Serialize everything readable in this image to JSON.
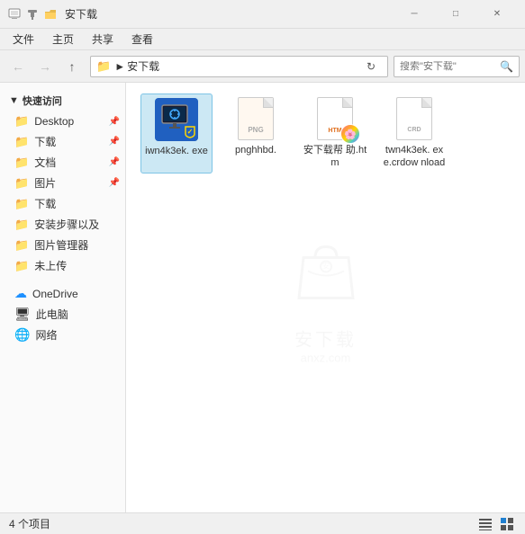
{
  "titlebar": {
    "title": "安下载",
    "controls": {
      "minimize": "─",
      "maximize": "□",
      "close": "✕"
    }
  },
  "menubar": {
    "items": [
      "文件",
      "主页",
      "共享",
      "查看"
    ]
  },
  "toolbar": {
    "back_title": "后退",
    "forward_title": "前进",
    "up_title": "向上",
    "address": "安下载",
    "address_folder": "▶",
    "refresh_title": "刷新",
    "search_placeholder": "搜索\"安下载\""
  },
  "sidebar": {
    "quick_access_label": "快速访问",
    "items": [
      {
        "label": "Desktop",
        "icon": "folder",
        "pinned": true
      },
      {
        "label": "下载",
        "icon": "folder",
        "pinned": true
      },
      {
        "label": "文档",
        "icon": "folder",
        "pinned": true
      },
      {
        "label": "图片",
        "icon": "folder",
        "pinned": true
      },
      {
        "label": "下载",
        "icon": "folder"
      },
      {
        "label": "安装步骤以及",
        "icon": "folder"
      },
      {
        "label": "图片管理器",
        "icon": "folder"
      },
      {
        "label": "未上传",
        "icon": "folder"
      }
    ],
    "onedrive_label": "OneDrive",
    "pc_label": "此电脑",
    "network_label": "网络"
  },
  "files": [
    {
      "name": "iwn4k3ek.\nexe",
      "type": "exe"
    },
    {
      "name": "pnghhbd.",
      "type": "generic"
    },
    {
      "name": "安下载帮\n助.htm",
      "type": "htm"
    },
    {
      "name": "twn4k3ek.\nexe.crdow\nnload",
      "type": "generic"
    }
  ],
  "statusbar": {
    "count_label": "4 个项目"
  },
  "watermark": {
    "text": "安下载",
    "subtext": "anxz.com"
  }
}
